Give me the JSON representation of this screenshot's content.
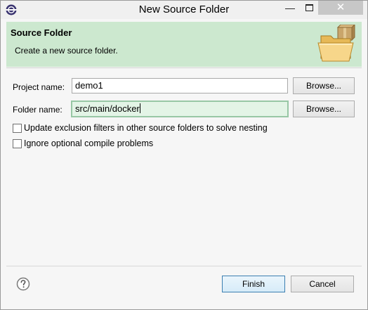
{
  "window": {
    "title": "New Source Folder",
    "minimize_glyph": "—",
    "close_glyph": "✕"
  },
  "banner": {
    "title": "Source Folder",
    "description": "Create a new source folder.",
    "icon": "folder-package-icon"
  },
  "form": {
    "project_name_label": "Project name:",
    "project_name_value": "demo1",
    "folder_name_label": "Folder name:",
    "folder_name_value": "src/main/docker",
    "browse_label": "Browse...",
    "options": [
      {
        "label": "Update exclusion filters in other source folders to solve nesting",
        "checked": false
      },
      {
        "label": "Ignore optional compile problems",
        "checked": false
      }
    ]
  },
  "footer": {
    "help_icon": "help-icon",
    "finish_label": "Finish",
    "cancel_label": "Cancel"
  },
  "colors": {
    "banner_bg": "#cce8cf",
    "focused_input_bg": "#e3f4e6",
    "default_button_border": "#3c7fb1"
  }
}
